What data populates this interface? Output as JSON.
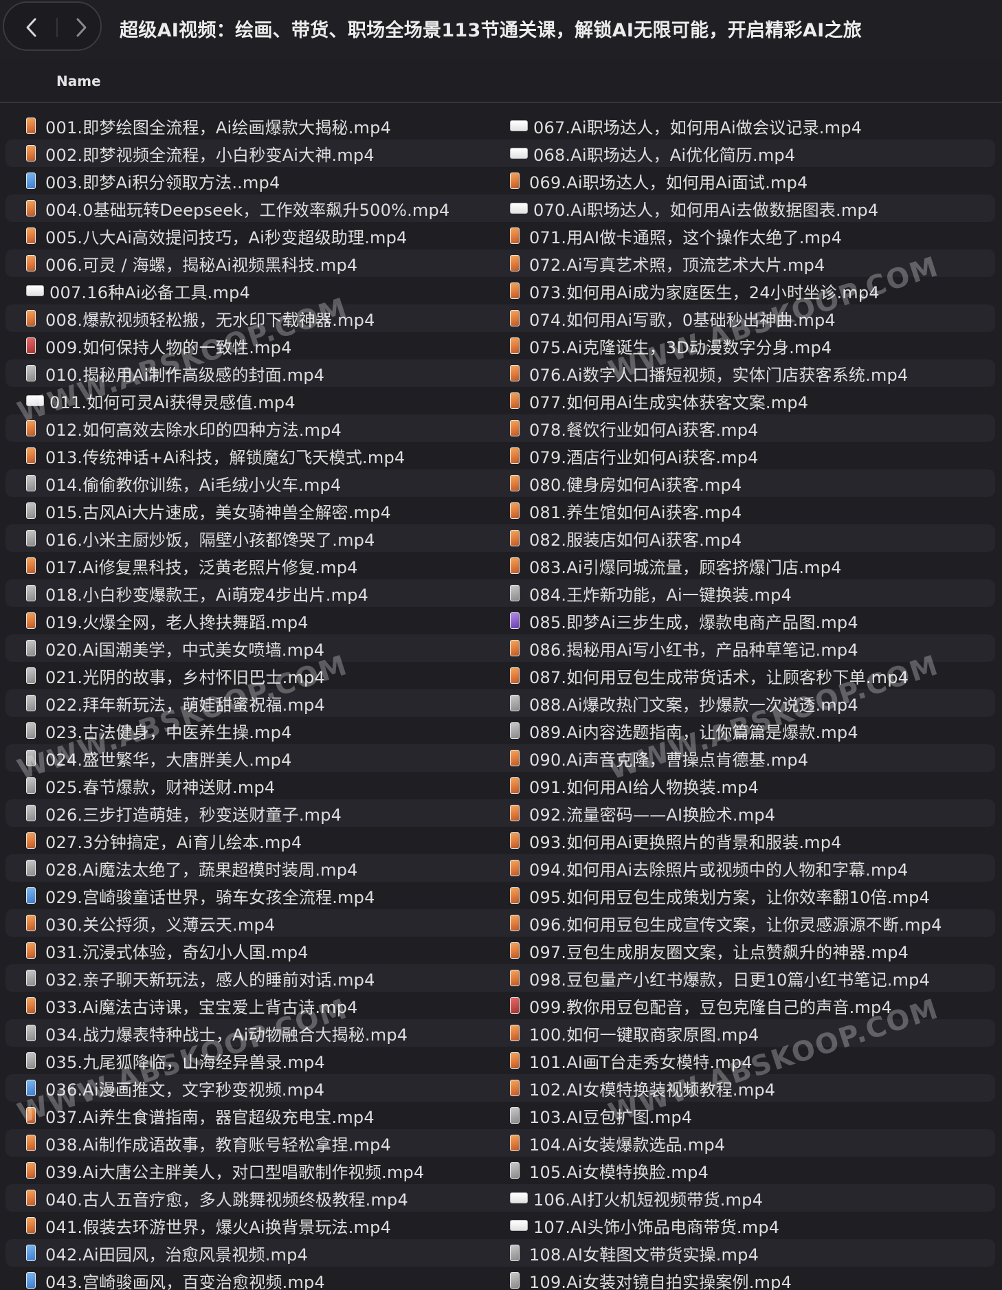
{
  "window": {
    "title": "超级AI视频：绘画、带货、职场全场景113节通关课，解锁AI无限可能，开启精彩AI之旅"
  },
  "toolbar": {
    "back_icon": "chevron-left-icon",
    "forward_icon": "chevron-right-icon"
  },
  "list_header": {
    "name_label": "Name"
  },
  "watermark": "WWW.ABSKOOP.COM",
  "files_left": [
    {
      "name": "001.即梦绘图全流程，Ai绘画爆款大揭秘.mp4",
      "icon": "video-file-icon"
    },
    {
      "name": "002.即梦视频全流程，小白秒变Ai大神.mp4",
      "icon": "video-file-icon"
    },
    {
      "name": "003.即梦Ai积分领取方法..mp4",
      "icon": "video-file-icon"
    },
    {
      "name": "004.0基础玩转Deepseek，工作效率飙升500%.mp4",
      "icon": "video-file-icon"
    },
    {
      "name": "005.八大Ai高效提问技巧，Ai秒变超级助理.mp4",
      "icon": "video-file-icon"
    },
    {
      "name": "006.可灵 / 海螺，揭秘Ai视频黑科技.mp4",
      "icon": "video-file-icon"
    },
    {
      "name": "007.16种Ai必备工具.mp4",
      "icon": "video-file-icon"
    },
    {
      "name": "008.爆款视频轻松搬，无水印下载神器.mp4",
      "icon": "video-file-icon"
    },
    {
      "name": "009.如何保持人物的一致性.mp4",
      "icon": "video-file-icon"
    },
    {
      "name": "010.揭秘用Ai制作高级感的封面.mp4",
      "icon": "video-file-icon"
    },
    {
      "name": "011.如何可灵Ai获得灵感值.mp4",
      "icon": "video-file-icon"
    },
    {
      "name": "012.如何高效去除水印的四种方法.mp4",
      "icon": "video-file-icon"
    },
    {
      "name": "013.传统神话+Ai科技，解锁魔幻飞天模式.mp4",
      "icon": "video-file-icon"
    },
    {
      "name": "014.偷偷教你训练，Ai毛绒小火车.mp4",
      "icon": "video-file-icon"
    },
    {
      "name": "015.古风Ai大片速成，美女骑神兽全解密.mp4",
      "icon": "video-file-icon"
    },
    {
      "name": "016.小米主厨炒饭，隔壁小孩都馋哭了.mp4",
      "icon": "video-file-icon"
    },
    {
      "name": "017.Ai修复黑科技，泛黄老照片修复.mp4",
      "icon": "video-file-icon"
    },
    {
      "name": "018.小白秒变爆款王，Ai萌宠4步出片.mp4",
      "icon": "video-file-icon"
    },
    {
      "name": "019.火爆全网，老人搀扶舞蹈.mp4",
      "icon": "video-file-icon"
    },
    {
      "name": "020.Ai国潮美学，中式美女喷墙.mp4",
      "icon": "video-file-icon"
    },
    {
      "name": "021.光阴的故事，乡村怀旧巴士.mp4",
      "icon": "video-file-icon"
    },
    {
      "name": "022.拜年新玩法，萌娃甜蜜祝福.mp4",
      "icon": "video-file-icon"
    },
    {
      "name": "023.古法健身，中医养生操.mp4",
      "icon": "video-file-icon"
    },
    {
      "name": "024.盛世繁华，大唐胖美人.mp4",
      "icon": "video-file-icon"
    },
    {
      "name": "025.春节爆款，财神送财.mp4",
      "icon": "video-file-icon"
    },
    {
      "name": "026.三步打造萌娃，秒变送财童子.mp4",
      "icon": "video-file-icon"
    },
    {
      "name": "027.3分钟搞定，Ai育儿绘本.mp4",
      "icon": "video-file-icon"
    },
    {
      "name": "028.Ai魔法太绝了，蔬果超模时装周.mp4",
      "icon": "video-file-icon"
    },
    {
      "name": "029.宫崎骏童话世界，骑车女孩全流程.mp4",
      "icon": "video-file-icon"
    },
    {
      "name": "030.关公捋须，义薄云天.mp4",
      "icon": "video-file-icon"
    },
    {
      "name": "031.沉浸式体验，奇幻小人国.mp4",
      "icon": "video-file-icon"
    },
    {
      "name": "032.亲子聊天新玩法，感人的睡前对话.mp4",
      "icon": "video-file-icon"
    },
    {
      "name": "033.Ai魔法古诗课，宝宝爱上背古诗.mp4",
      "icon": "video-file-icon"
    },
    {
      "name": "034.战力爆表特种战士，Ai动物融合大揭秘.mp4",
      "icon": "video-file-icon"
    },
    {
      "name": "035.九尾狐降临，山海经异兽录.mp4",
      "icon": "video-file-icon"
    },
    {
      "name": "036.Ai漫画推文，文字秒变视频.mp4",
      "icon": "video-file-icon"
    },
    {
      "name": "037.Ai养生食谱指南，器官超级充电宝.mp4",
      "icon": "video-file-icon"
    },
    {
      "name": "038.Ai制作成语故事，教育账号轻松拿捏.mp4",
      "icon": "video-file-icon"
    },
    {
      "name": "039.Ai大唐公主胖美人，对口型唱歌制作视频.mp4",
      "icon": "video-file-icon"
    },
    {
      "name": "040.古人五音疗愈，多人跳舞视频终极教程.mp4",
      "icon": "video-file-icon"
    },
    {
      "name": "041.假装去环游世界，爆火Ai换背景玩法.mp4",
      "icon": "video-file-icon"
    },
    {
      "name": "042.Ai田园风，治愈风景视频.mp4",
      "icon": "video-file-icon"
    },
    {
      "name": "043.宫崎骏画风，百变治愈视频.mp4",
      "icon": "video-file-icon"
    }
  ],
  "files_right": [
    {
      "name": "067.Ai职场达人，如何用Ai做会议记录.mp4",
      "icon": "video-file-icon"
    },
    {
      "name": "068.Ai职场达人，Ai优化简历.mp4",
      "icon": "video-file-icon"
    },
    {
      "name": "069.Ai职场达人，如何用Ai面试.mp4",
      "icon": "video-file-icon"
    },
    {
      "name": "070.Ai职场达人，如何用Ai去做数据图表.mp4",
      "icon": "video-file-icon"
    },
    {
      "name": "071.用AI做卡通照，这个操作太绝了.mp4",
      "icon": "video-file-icon"
    },
    {
      "name": "072.Ai写真艺术照，顶流艺术大片.mp4",
      "icon": "video-file-icon"
    },
    {
      "name": "073.如何用Ai成为家庭医生，24小时坐诊.mp4",
      "icon": "video-file-icon"
    },
    {
      "name": "074.如何用Ai写歌，0基础秒出神曲.mp4",
      "icon": "video-file-icon"
    },
    {
      "name": "075.Ai克隆诞生，3D动漫数字分身.mp4",
      "icon": "video-file-icon"
    },
    {
      "name": "076.Ai数字人口播短视频，实体门店获客系统.mp4",
      "icon": "video-file-icon"
    },
    {
      "name": "077.如何用Ai生成实体获客文案.mp4",
      "icon": "video-file-icon"
    },
    {
      "name": "078.餐饮行业如何Ai获客.mp4",
      "icon": "video-file-icon"
    },
    {
      "name": "079.酒店行业如何Ai获客.mp4",
      "icon": "video-file-icon"
    },
    {
      "name": "080.健身房如何Ai获客.mp4",
      "icon": "video-file-icon"
    },
    {
      "name": "081.养生馆如何Ai获客.mp4",
      "icon": "video-file-icon"
    },
    {
      "name": "082.服装店如何Ai获客.mp4",
      "icon": "video-file-icon"
    },
    {
      "name": "083.Ai引爆同城流量，顾客挤爆门店.mp4",
      "icon": "video-file-icon"
    },
    {
      "name": "084.王炸新功能，Ai一键换装.mp4",
      "icon": "video-file-icon"
    },
    {
      "name": "085.即梦Ai三步生成，爆款电商产品图.mp4",
      "icon": "video-file-icon"
    },
    {
      "name": "086.揭秘用Ai写小红书，产品种草笔记.mp4",
      "icon": "video-file-icon"
    },
    {
      "name": "087.如何用豆包生成带货话术，让顾客秒下单.mp4",
      "icon": "video-file-icon"
    },
    {
      "name": "088.Ai爆改热门文案，抄爆款一次说透.mp4",
      "icon": "video-file-icon"
    },
    {
      "name": "089.Ai内容选题指南，让你篇篇是爆款.mp4",
      "icon": "video-file-icon"
    },
    {
      "name": "090.Ai声音克隆，曹操点肯德基.mp4",
      "icon": "video-file-icon"
    },
    {
      "name": "091.如何用AI给人物换装.mp4",
      "icon": "video-file-icon"
    },
    {
      "name": "092.流量密码——AI换脸术.mp4",
      "icon": "video-file-icon"
    },
    {
      "name": "093.如何用Ai更换照片的背景和服装.mp4",
      "icon": "video-file-icon"
    },
    {
      "name": "094.如何用Ai去除照片或视频中的人物和字幕.mp4",
      "icon": "video-file-icon"
    },
    {
      "name": "095.如何用豆包生成策划方案，让你效率翻10倍.mp4",
      "icon": "video-file-icon"
    },
    {
      "name": "096.如何用豆包生成宣传文案，让你灵感源源不断.mp4",
      "icon": "video-file-icon"
    },
    {
      "name": "097.豆包生成朋友圈文案，让点赞飙升的神器.mp4",
      "icon": "video-file-icon"
    },
    {
      "name": "098.豆包量产小红书爆款，日更10篇小红书笔记.mp4",
      "icon": "video-file-icon"
    },
    {
      "name": "099.教你用豆包配音，豆包克隆自己的声音.mp4",
      "icon": "video-file-icon"
    },
    {
      "name": "100.如何一键取商家原图.mp4",
      "icon": "video-file-icon"
    },
    {
      "name": "101.AI画T台走秀女模特.mp4",
      "icon": "video-file-icon"
    },
    {
      "name": "102.AI女模特换装视频教程.mp4",
      "icon": "video-file-icon"
    },
    {
      "name": "103.AI豆包扩图.mp4",
      "icon": "video-file-icon"
    },
    {
      "name": "104.Ai女装爆款选品.mp4",
      "icon": "video-file-icon"
    },
    {
      "name": "105.Ai女模特换脸.mp4",
      "icon": "video-file-icon"
    },
    {
      "name": "106.AI打火机短视频带货.mp4",
      "icon": "video-file-icon"
    },
    {
      "name": "107.AI头饰小饰品电商带货.mp4",
      "icon": "video-file-icon"
    },
    {
      "name": "108.AI女鞋图文带货实操.mp4",
      "icon": "video-file-icon"
    },
    {
      "name": "109.Ai女装对镜自拍实操案例.mp4",
      "icon": "video-file-icon"
    }
  ]
}
